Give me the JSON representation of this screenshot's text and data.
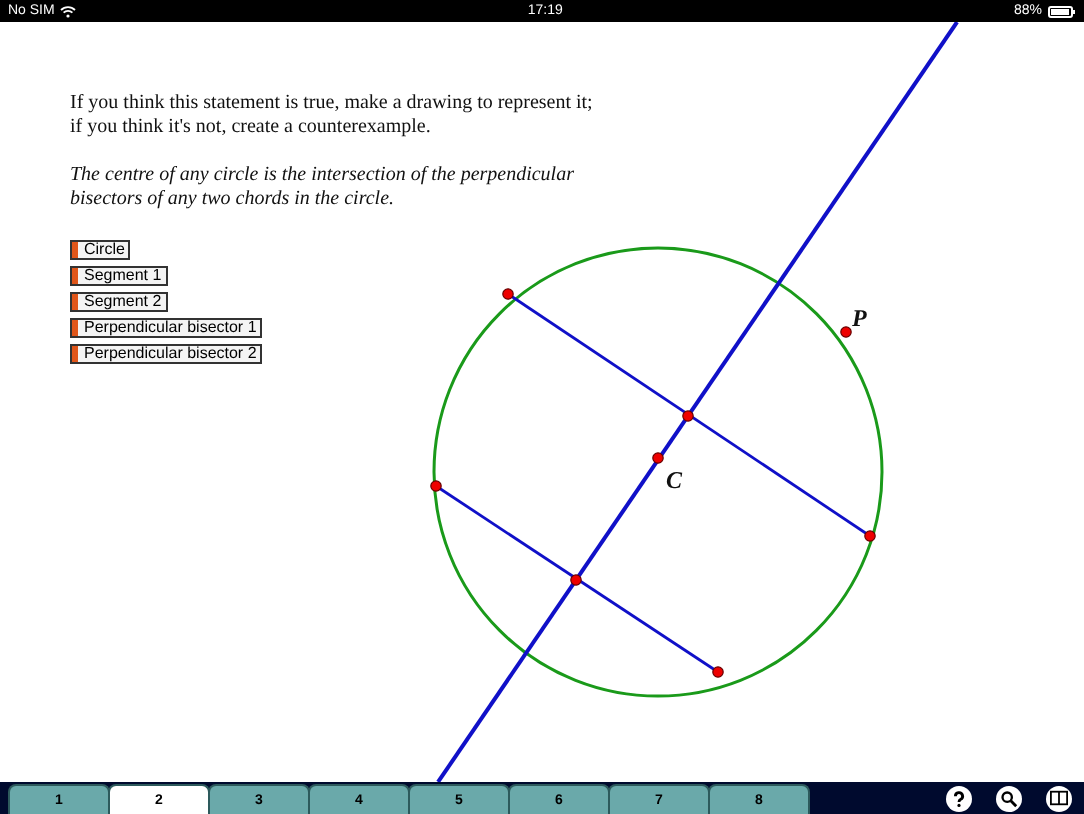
{
  "status_bar": {
    "carrier": "No SIM",
    "time": "17:19",
    "battery": "88%"
  },
  "instructions": [
    "If you think this statement is true, make a drawing to represent it;",
    "if you think it's not, create a counterexample."
  ],
  "statement": [
    "The centre of any circle is the intersection of the perpendicular",
    "bisectors of any two chords in the circle."
  ],
  "objects": [
    {
      "label": "Circle"
    },
    {
      "label": "Segment 1"
    },
    {
      "label": "Segment 2"
    },
    {
      "label": "Perpendicular bisector 1"
    },
    {
      "label": "Perpendicular bisector 2"
    }
  ],
  "point_labels": [
    {
      "text": "C"
    },
    {
      "text": "P"
    }
  ],
  "tabs": [
    {
      "label": "1",
      "selected": false
    },
    {
      "label": "2",
      "selected": true
    },
    {
      "label": "3",
      "selected": false
    },
    {
      "label": "4",
      "selected": false
    },
    {
      "label": "5",
      "selected": false
    },
    {
      "label": "6",
      "selected": false
    },
    {
      "label": "7",
      "selected": false
    },
    {
      "label": "8",
      "selected": false
    }
  ],
  "toolbar": [
    {
      "kind": "help"
    },
    {
      "kind": "zoom"
    },
    {
      "kind": "book"
    }
  ]
}
